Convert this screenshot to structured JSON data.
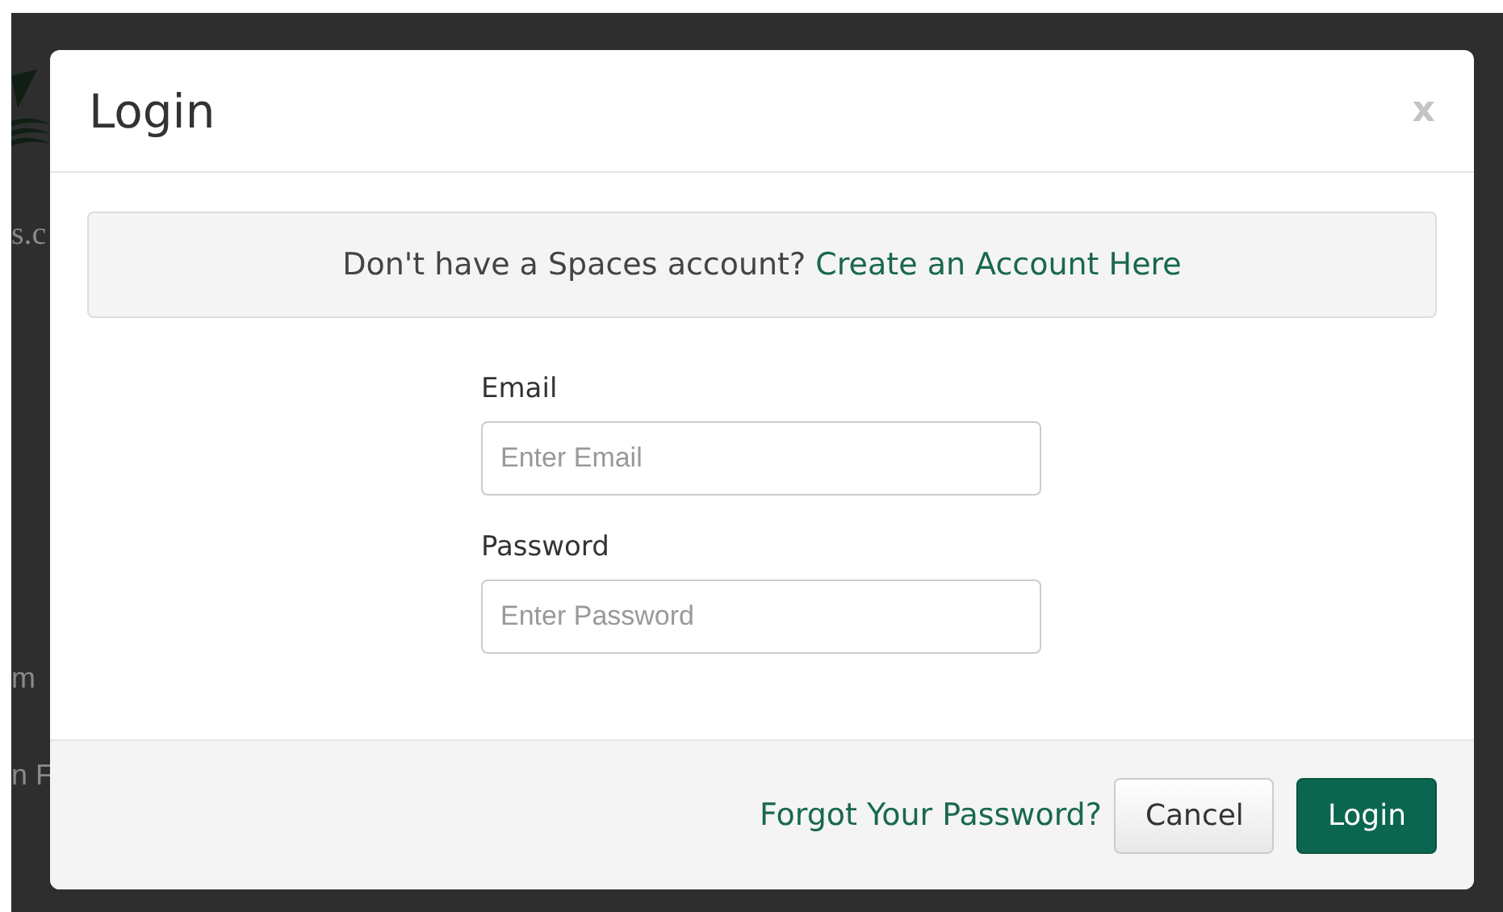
{
  "backdrop": {
    "fragments": [
      "s.c",
      "m",
      "n F"
    ]
  },
  "modal": {
    "title": "Login",
    "close": "x",
    "notice": {
      "text": "Don't have a Spaces account?",
      "link": "Create an Account Here"
    },
    "fields": [
      {
        "label": "Email",
        "placeholder": "Enter Email"
      },
      {
        "label": "Password",
        "placeholder": "Enter Password"
      }
    ],
    "footer": {
      "link": "Forgot Your Password?",
      "buttons": [
        {
          "label": "Cancel",
          "kind": "secondary"
        },
        {
          "label": "Login",
          "kind": "primary"
        }
      ]
    }
  }
}
